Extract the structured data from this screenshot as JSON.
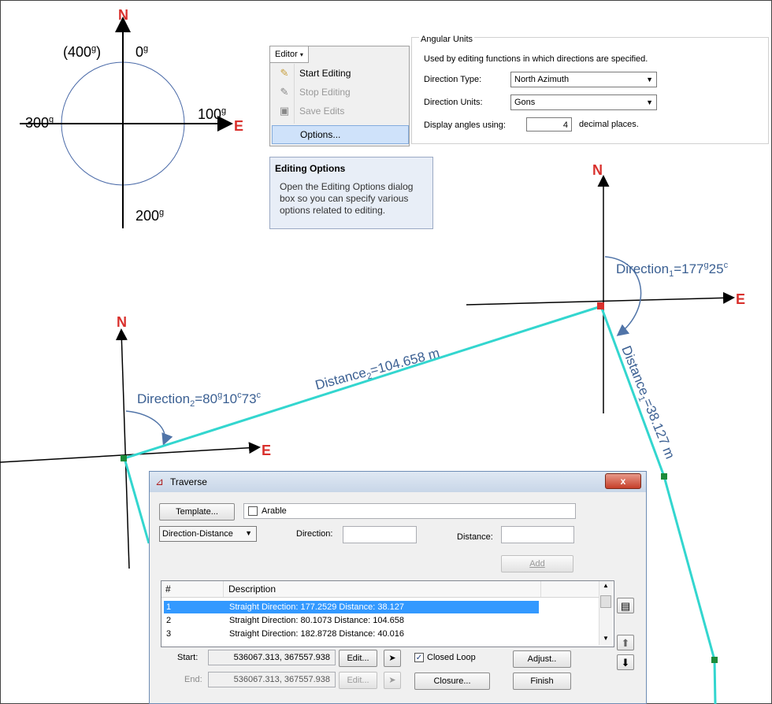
{
  "compass": {
    "north": "N",
    "east": "E",
    "label_0": "0",
    "label_400": "(400",
    "label_400_close": ")",
    "label_100": "100",
    "label_200": "200",
    "label_300": "300",
    "grad_mark": "g"
  },
  "diagram": {
    "north_right": "N",
    "east_right": "E",
    "north_left": "N",
    "east_left": "E",
    "direction1": "Direction",
    "direction1_sub": "1",
    "direction1_value": "=177",
    "direction1_g": "g",
    "direction1_tail": "25",
    "direction1_c": "c",
    "distance1": "Distance",
    "distance1_sub": "1",
    "distance1_value": "=38.127 m",
    "direction2": "Direction",
    "direction2_sub": "2",
    "direction2_value": "=80",
    "direction2_g": "g",
    "direction2_mid": "10",
    "direction2_c": "c",
    "direction2_tail": "73",
    "direction2_c2": "c",
    "distance2": "Distance",
    "distance2_sub": "2",
    "distance2_value": "=104.658 m",
    "line_color": "#33d6cf",
    "accent_red": "#d9302c"
  },
  "editor_menu": {
    "button_label": "Editor",
    "items": [
      {
        "label": "Start Editing",
        "icon": "pencil-icon",
        "enabled": true
      },
      {
        "label": "Stop Editing",
        "icon": "pencil-stop-icon",
        "enabled": false
      },
      {
        "label": "Save Edits",
        "icon": "save-icon",
        "enabled": false
      },
      {
        "label": "Options...",
        "icon": "",
        "enabled": true
      }
    ]
  },
  "tooltip": {
    "title": "Editing Options",
    "text": "Open the Editing Options dialog box so you can specify various options related to editing."
  },
  "angular_units": {
    "title": "Angular Units",
    "description": "Used by editing functions in which directions are specified.",
    "direction_type_label": "Direction Type:",
    "direction_type_value": "North Azimuth",
    "direction_units_label": "Direction Units:",
    "direction_units_value": "Gons",
    "display_label": "Display angles using:",
    "decimal_places": "4",
    "decimal_suffix": "decimal places."
  },
  "traverse": {
    "title": "Traverse",
    "close_label": "x",
    "template_button": "Template...",
    "template_value": "Arable",
    "mode_value": "Direction-Distance",
    "direction_label": "Direction:",
    "direction_value": "",
    "distance_label": "Distance:",
    "distance_value": "",
    "add_button": "Add",
    "columns": [
      "#",
      "Description"
    ],
    "rows": [
      {
        "num": "1",
        "desc": "Straight  Direction: 177.2529  Distance: 38.127"
      },
      {
        "num": "2",
        "desc": "Straight  Direction: 80.1073  Distance: 104.658"
      },
      {
        "num": "3",
        "desc": "Straight  Direction: 182.8728  Distance: 40.016"
      }
    ],
    "start_label": "Start:",
    "start_value": "536067.313, 367557.938",
    "end_label": "End:",
    "end_value": "536067.313, 367557.938",
    "edit_button": "Edit...",
    "closed_loop_label": "Closed Loop",
    "closed_loop_checked": true,
    "adjust_button": "Adjust..",
    "closure_button": "Closure...",
    "finish_button": "Finish"
  }
}
